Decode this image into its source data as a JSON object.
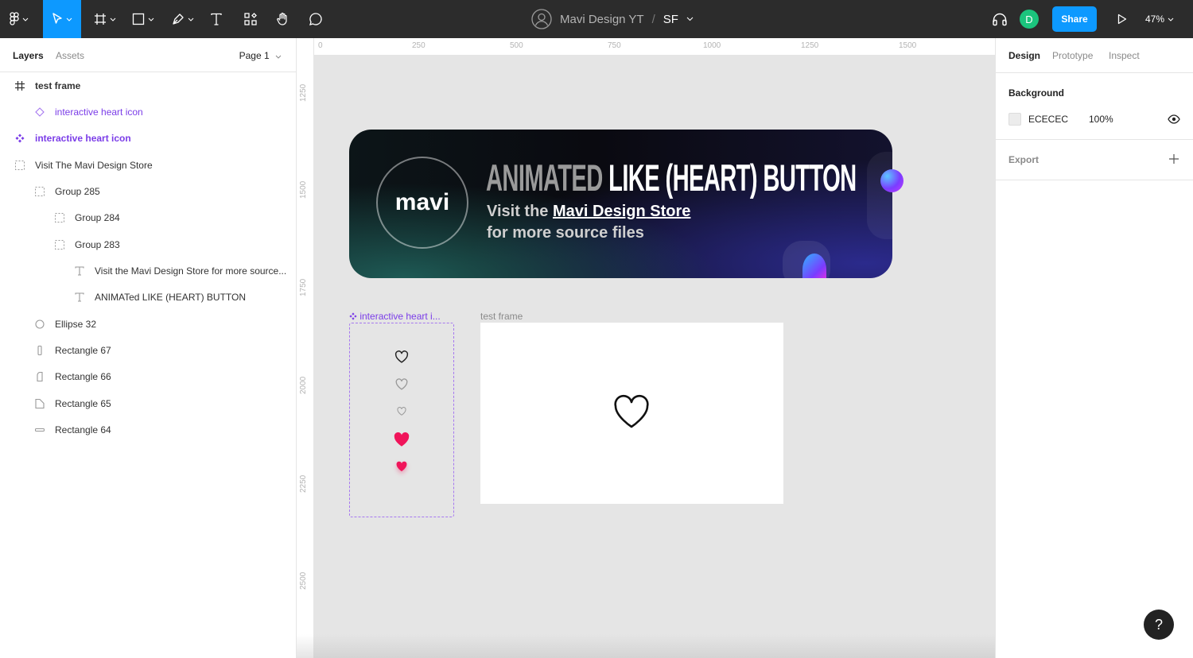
{
  "toolbar": {
    "project": "Mavi Design YT",
    "separator": "/",
    "file_name": "SF",
    "share_label": "Share",
    "avatar_initial": "D",
    "zoom": "47%"
  },
  "left_panel": {
    "tabs": [
      "Layers",
      "Assets"
    ],
    "page": "Page 1",
    "layers": [
      {
        "label": "test frame",
        "icon": "frame-icon"
      },
      {
        "label": "interactive heart icon",
        "icon": "component-instance-icon"
      },
      {
        "label": "interactive heart icon",
        "icon": "component-icon"
      },
      {
        "label": "Visit The Mavi Design Store",
        "icon": "group-icon"
      },
      {
        "label": "Group 285",
        "icon": "group-icon"
      },
      {
        "label": "Group 284",
        "icon": "group-icon"
      },
      {
        "label": "Group 283",
        "icon": "group-icon"
      },
      {
        "label": "Visit the Mavi Design Store for more source...",
        "icon": "text-icon"
      },
      {
        "label": "ANIMATed LIKE (HEART) BUTTON",
        "icon": "text-icon"
      },
      {
        "label": "Ellipse 32",
        "icon": "ellipse-icon"
      },
      {
        "label": "Rectangle 67",
        "icon": "rectangle-icon"
      },
      {
        "label": "Rectangle 66",
        "icon": "rectangle-icon"
      },
      {
        "label": "Rectangle 65",
        "icon": "rectangle-icon"
      },
      {
        "label": "Rectangle 64",
        "icon": "rectangle-icon"
      }
    ]
  },
  "canvas": {
    "ruler_top": [
      "0",
      "250",
      "500",
      "750",
      "1000",
      "1250",
      "1500"
    ],
    "ruler_left": [
      "1250",
      "1500",
      "1750",
      "2000",
      "2250",
      "2500"
    ],
    "banner": {
      "logo": "mavi",
      "title_dim": "ANIMATED",
      "title_bright": "LIKE (HEART) BUTTON",
      "sub_prefix": "Visit the ",
      "sub_link": "Mavi Design Store",
      "sub_line2": "for more source files"
    },
    "component_label": "interactive heart i...",
    "frame_label": "test frame"
  },
  "right_panel": {
    "tabs": [
      "Design",
      "Prototype",
      "Inspect"
    ],
    "background_title": "Background",
    "background_hex": "ECECEC",
    "background_opacity": "100%",
    "export_title": "Export"
  },
  "help_label": "?",
  "colors": {
    "toolbar": "#2c2c2c",
    "accent": "#0d99ff",
    "component_purple": "#7b3de8",
    "heart_filled": "#f0145a",
    "canvas": "#e5e5e5"
  }
}
